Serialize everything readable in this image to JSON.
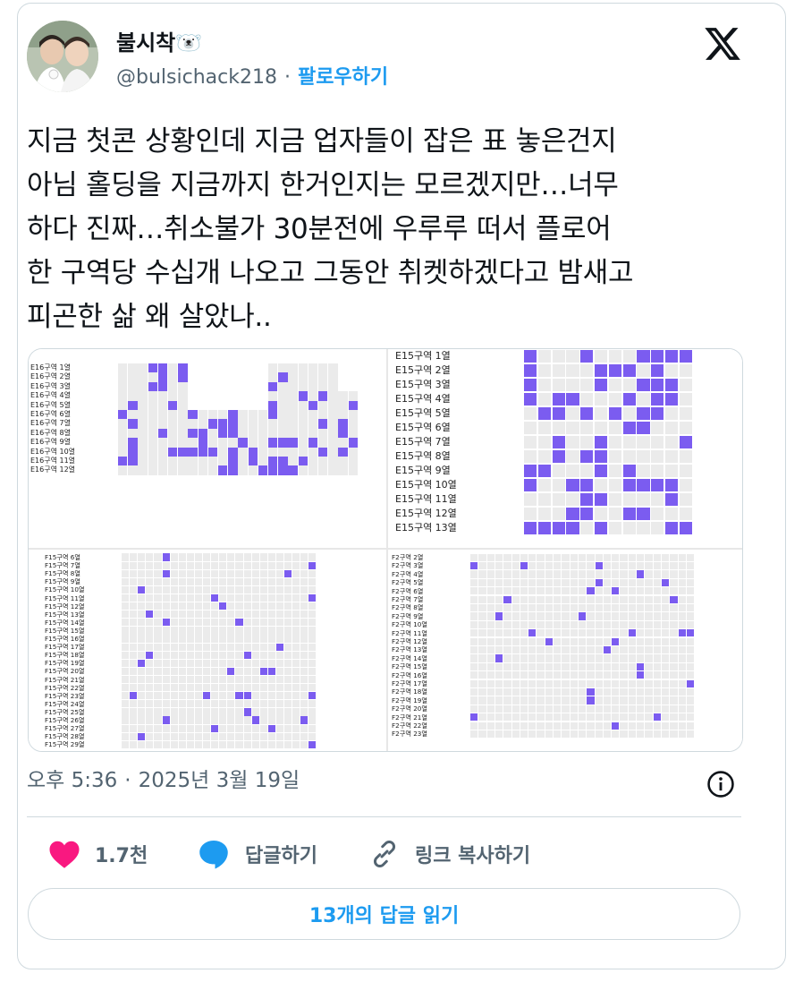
{
  "author": {
    "display_name": "불시착🐻‍❄️",
    "handle": "@bulsichack218",
    "separator": "·",
    "follow_label": "팔로우하기"
  },
  "tweet": {
    "lines": [
      "지금 첫콘 상황인데 지금 업자들이 잡은 표 놓은건지",
      "아님 홀딩을 지금까지 한거인지는 모르겠지만…너무",
      "하다 진짜…취소불가 30분전에 우루루 떠서 플로어",
      "한 구역당 수십개 나오고 그동안 취켓하겠다고 밤새고",
      "피곤한 삶 왜 살았나.."
    ]
  },
  "media": {
    "panels": [
      {
        "id": "E16",
        "rows": [
          "E16구역 1열",
          "E16구역 2열",
          "E16구역 3열",
          "E16구역 4열",
          "E16구역 5열",
          "E16구역 6열",
          "E16구역 7열",
          "E16구역 8열",
          "E16구역 9열",
          "E16구역 10열",
          "E16구역 11열",
          "E16구역 12열"
        ]
      },
      {
        "id": "E15",
        "rows": [
          "E15구역 1열",
          "E15구역 2열",
          "E15구역 3열",
          "E15구역 4열",
          "E15구역 5열",
          "E15구역 6열",
          "E15구역 7열",
          "E15구역 8열",
          "E15구역 9열",
          "E15구역 10열",
          "E15구역 11열",
          "E15구역 12열",
          "E15구역 13열"
        ]
      },
      {
        "id": "F15",
        "rows": [
          "F15구역 6열",
          "F15구역 7열",
          "F15구역 8열",
          "F15구역 9열",
          "F15구역 10열",
          "F15구역 11열",
          "F15구역 12열",
          "F15구역 13열",
          "F15구역 14열",
          "F15구역 15열",
          "F15구역 16열",
          "F15구역 17열",
          "F15구역 18열",
          "F15구역 19열",
          "F15구역 20열",
          "F15구역 21열",
          "F15구역 22열",
          "F15구역 23열",
          "F15구역 24열",
          "F15구역 25열",
          "F15구역 26열",
          "F15구역 27열",
          "F15구역 28열",
          "F15구역 29열"
        ]
      },
      {
        "id": "F2",
        "rows": [
          "F2구역 2열",
          "F2구역 3열",
          "F2구역 4열",
          "F2구역 5열",
          "F2구역 6열",
          "F2구역 7열",
          "F2구역 8열",
          "F2구역 9열",
          "F2구역 10열",
          "F2구역 11열",
          "F2구역 12열",
          "F2구역 13열",
          "F2구역 14열",
          "F2구역 15열",
          "F2구역 16열",
          "F2구역 17열",
          "F2구역 18열",
          "F2구역 19열",
          "F2구역 20열",
          "F2구역 21열",
          "F2구역 22열",
          "F2구역 23열"
        ]
      }
    ],
    "colors": {
      "available": "#7b5cf0",
      "empty": "#ebebeb"
    }
  },
  "meta": {
    "time": "오후 5:36",
    "separator": "·",
    "date": "2025년 3월 19일"
  },
  "actions": {
    "likes": "1.7천",
    "reply_label": "답글하기",
    "copy_link_label": "링크 복사하기",
    "read_replies_label": "13개의 답글 읽기"
  },
  "colors": {
    "accent": "#1d9bf0",
    "like": "#f91880",
    "muted": "#536471"
  }
}
